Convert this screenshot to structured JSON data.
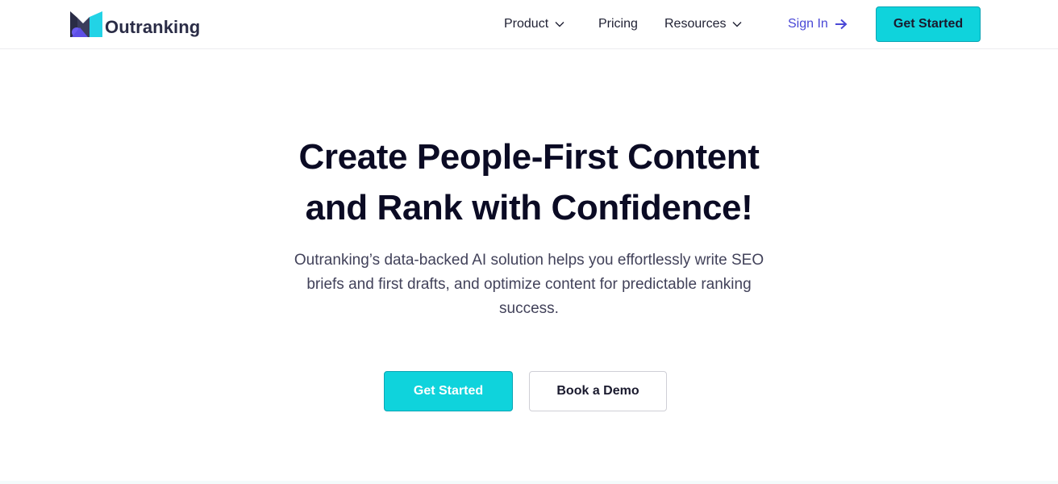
{
  "brand": {
    "name": "Outranking",
    "logo_icon": "outranking-logo-icon",
    "colors": {
      "accent": "#0fd3dc",
      "accent_border": "#0aa5b4",
      "signin": "#4a48d6",
      "logo_dark": "#2a2c46",
      "logo_purple": "#6b5cf0",
      "logo_cyan": "#22d3e6"
    }
  },
  "nav": {
    "product": "Product",
    "pricing": "Pricing",
    "resources": "Resources",
    "dropdown_icon": "chevron-down-icon"
  },
  "auth": {
    "sign_in": "Sign In",
    "sign_in_icon": "arrow-right-icon",
    "get_started": "Get Started"
  },
  "hero": {
    "title_line1": "Create People-First Content",
    "title_line2": "and Rank with Confidence!",
    "subtitle": "Outranking’s data-backed AI solution helps you effortlessly write SEO briefs and first drafts, and optimize content for predictable ranking success.",
    "cta_primary": "Get Started",
    "cta_secondary": "Book a Demo"
  }
}
